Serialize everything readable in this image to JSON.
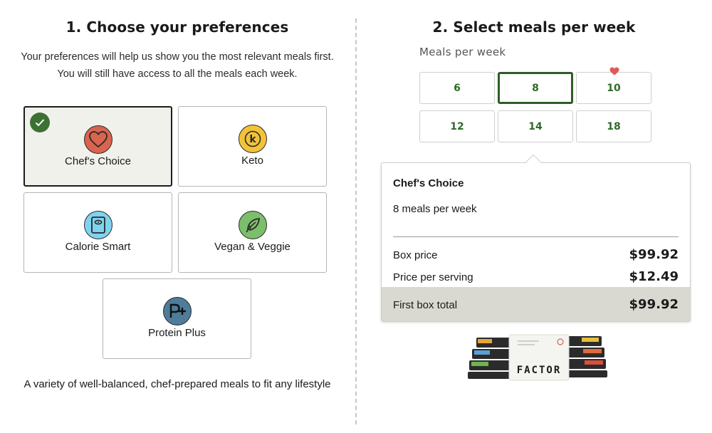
{
  "left": {
    "title": "1. Choose your preferences",
    "description": "Your preferences will help us show you the most relevant meals first. You will still have access to all the meals each week.",
    "preferences": [
      {
        "label": "Chef's Choice",
        "icon": "heart-icon",
        "color": "#d9644f",
        "selected": true
      },
      {
        "label": "Keto",
        "icon": "keto-k-icon",
        "color": "#f2c33a",
        "selected": false
      },
      {
        "label": "Calorie Smart",
        "icon": "scale-icon",
        "color": "#7fd3ee",
        "selected": false
      },
      {
        "label": "Vegan & Veggie",
        "icon": "leaf-icon",
        "color": "#7cbf6b",
        "selected": false
      },
      {
        "label": "Protein Plus",
        "icon": "protein-p-plus-icon",
        "color": "#4e7d9b",
        "selected": false
      }
    ],
    "footer": "A variety of well-balanced, chef-prepared meals to fit any lifestyle"
  },
  "right": {
    "title": "2. Select meals per week",
    "meals_label": "Meals per week",
    "meal_options": [
      "6",
      "8",
      "10",
      "12",
      "14",
      "18"
    ],
    "selected_meals": "8",
    "popular_option": "10",
    "summary": {
      "plan": "Chef's Choice",
      "meals_text": "8 meals per week",
      "box_price_label": "Box price",
      "box_price": "$99.92",
      "per_serving_label": "Price per serving",
      "per_serving": "$12.49",
      "total_label": "First box total",
      "total": "$99.92"
    },
    "brand": "FACTOR"
  },
  "colors": {
    "accent_green": "#2f6b2a",
    "check_green": "#3d7133",
    "heart_red": "#e05a5a"
  }
}
